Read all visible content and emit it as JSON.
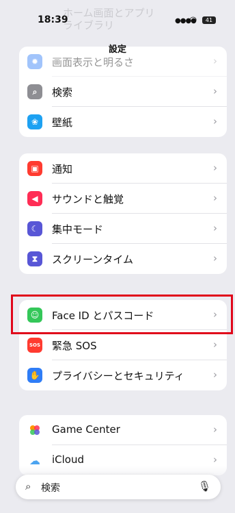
{
  "status_bar": {
    "time": "18:39",
    "battery": "41"
  },
  "nav": {
    "title": "設定",
    "ghost_text_line1": "ホーム画面とアプリ",
    "ghost_text_line2": "ライブラリ"
  },
  "groups": [
    {
      "items": [
        {
          "label": "画面表示と明るさ",
          "icon": "sun-icon",
          "color": "#2f7df6",
          "faded": true
        },
        {
          "label": "検索",
          "icon": "search-icon",
          "color": "#8e8e93"
        },
        {
          "label": "壁紙",
          "icon": "flower-icon",
          "color": "#1da1f2"
        }
      ]
    },
    {
      "items": [
        {
          "label": "通知",
          "icon": "bell-icon",
          "color": "#ff3b30"
        },
        {
          "label": "サウンドと触覚",
          "icon": "speaker-icon",
          "color": "#ff2d55"
        },
        {
          "label": "集中モード",
          "icon": "moon-icon",
          "color": "#5856d6"
        },
        {
          "label": "スクリーンタイム",
          "icon": "hourglass-icon",
          "color": "#5856d6"
        }
      ]
    },
    {
      "items": [
        {
          "label": "Face ID とパスコード",
          "icon": "faceid-icon",
          "color": "#34c759"
        },
        {
          "label": "緊急 SOS",
          "icon": "sos-icon",
          "color": "#ff3b30",
          "icon_text": "SOS"
        },
        {
          "label": "プライバシーとセキュリティ",
          "icon": "hand-icon",
          "color": "#2f7df6"
        }
      ]
    },
    {
      "items": [
        {
          "label": "Game Center",
          "icon": "gamecenter-icon",
          "color": "#ff9500"
        },
        {
          "label": "iCloud",
          "icon": "cloud-icon",
          "color": "#4aa3f0"
        }
      ]
    }
  ],
  "search": {
    "placeholder": "検索"
  },
  "colors": {
    "highlight": "#e0061a",
    "background": "#ebebf0"
  }
}
